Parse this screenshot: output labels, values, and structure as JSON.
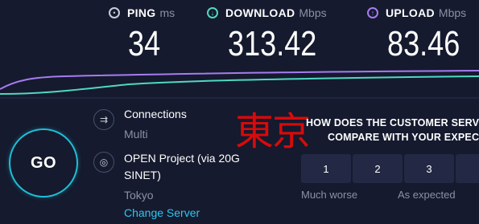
{
  "colors": {
    "background": "#151a2e",
    "download_accent": "#4fd8c4",
    "upload_accent": "#a67cf0",
    "go_ring": "#1fbfd6",
    "link": "#2ec5f0",
    "stamp": "#d90a0a"
  },
  "metrics": {
    "ping": {
      "icon": "ping-icon",
      "label": "PING",
      "unit": "ms",
      "value": "34"
    },
    "download": {
      "icon": "download-arrow-icon",
      "label": "DOWNLOAD",
      "unit": "Mbps",
      "value": "313.42"
    },
    "upload": {
      "icon": "upload-arrow-icon",
      "label": "UPLOAD",
      "unit": "Mbps",
      "value": "83.46"
    }
  },
  "connections": {
    "icon": "connections-icon",
    "title": "Connections",
    "value": "Multi"
  },
  "server": {
    "icon": "globe-icon",
    "name_line1": "OPEN Project (via 20G",
    "name_line2": "SINET)",
    "location": "Tokyo",
    "change_label": "Change Server"
  },
  "go_button": {
    "label": "GO"
  },
  "stamp_text": "東京",
  "survey": {
    "question_line1": "HOW DOES THE CUSTOMER SERV",
    "question_line2": "COMPARE WITH YOUR EXPEC",
    "ratings": [
      "1",
      "2",
      "3",
      ""
    ],
    "scale_low": "Much worse",
    "scale_mid": "As expected"
  }
}
